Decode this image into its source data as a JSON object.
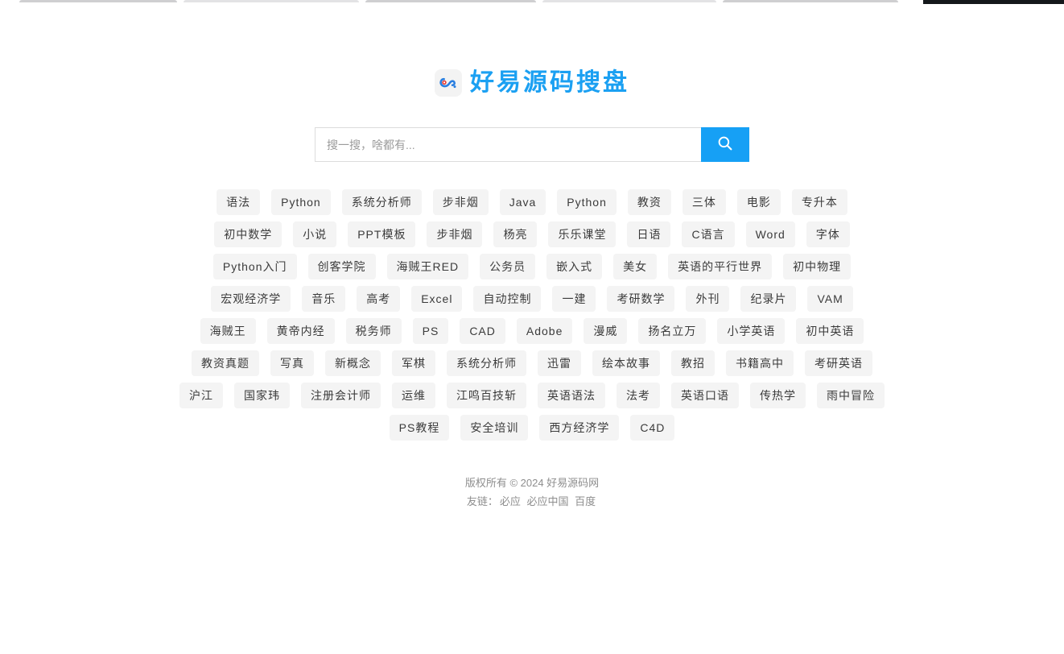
{
  "browser": {
    "black_bar_color": "#14181b",
    "tab_color": "#cfcfd1"
  },
  "brand": {
    "logo_icon": "baidu-cloud-paw-icon",
    "title": "好易源码搜盘",
    "title_color": "#1ba0f2"
  },
  "search": {
    "placeholder": "搜一搜，啥都有...",
    "value": "",
    "button_icon": "search-icon",
    "button_color": "#16a0f5",
    "button_label": ""
  },
  "tags": {
    "rows": [
      [
        "语法",
        "Python",
        "系统分析师",
        "步非烟",
        "Java",
        "Python",
        "教资",
        "三体",
        "电影",
        "专升本"
      ],
      [
        "初中数学",
        "小说",
        "PPT模板",
        "步非烟",
        "杨亮",
        "乐乐课堂",
        "日语",
        "C语言",
        "Word",
        "字体"
      ],
      [
        "Python入门",
        "创客学院",
        "海贼王RED",
        "公务员",
        "嵌入式",
        "美女",
        "英语的平行世界",
        "初中物理"
      ],
      [
        "宏观经济学",
        "音乐",
        "高考",
        "Excel",
        "自动控制",
        "一建",
        "考研数学",
        "外刊",
        "纪录片",
        "VAM"
      ],
      [
        "海贼王",
        "黄帝内经",
        "税务师",
        "PS",
        "CAD",
        "Adobe",
        "漫威",
        "扬名立万",
        "小学英语",
        "初中英语"
      ],
      [
        "教资真题",
        "写真",
        "新概念",
        "军棋",
        "系统分析师",
        "迅雷",
        "绘本故事",
        "教招",
        "书籍高中",
        "考研英语"
      ],
      [
        "沪江",
        "国家玮",
        "注册会计师",
        "运维",
        "江鸣百技斩",
        "英语语法",
        "法考",
        "英语口语",
        "传热学",
        "雨中冒险"
      ],
      [
        "PS教程",
        "安全培训",
        "西方经济学",
        "C4D"
      ]
    ]
  },
  "footer": {
    "copyright": "版权所有 © 2024 好易源码网",
    "friend_label": "友链：",
    "friend_links": [
      "必应",
      "必应中国",
      "百度"
    ]
  }
}
